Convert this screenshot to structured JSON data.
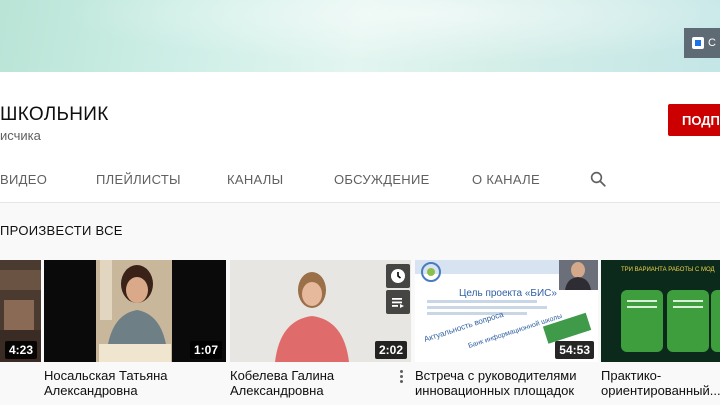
{
  "banner": {
    "link_label": "С"
  },
  "channel": {
    "title": "ШКОЛЬНИК",
    "subscribers": "исчика",
    "subscribe_label": "ПОДПИ"
  },
  "tabs": [
    {
      "label": "ВИДЕО"
    },
    {
      "label": "ПЛЕЙЛИСТЫ"
    },
    {
      "label": "КАНАЛЫ"
    },
    {
      "label": "ОБСУЖДЕНИЕ"
    },
    {
      "label": "О КАНАЛЕ"
    }
  ],
  "section": {
    "play_all": "ПРОИЗВЕСТИ ВСЕ"
  },
  "videos": [
    {
      "duration": "4:23",
      "title_line1": "",
      "title_line2": ""
    },
    {
      "duration": "1:07",
      "title_line1": "Носальская Татьяна",
      "title_line2": "Александровна"
    },
    {
      "duration": "2:02",
      "title_line1": "Кобелева Галина",
      "title_line2": "Александровна"
    },
    {
      "duration": "54:53",
      "title_line1": "Встреча с руководителями",
      "title_line2": "инновационных площадок",
      "slide_title": "Цель проекта «БИС»",
      "slide_text1": "Актуальность вопроса",
      "slide_text2": "Банк информационной школы"
    },
    {
      "duration": "",
      "title_line1": "Практико-",
      "title_line2": "ориентированный...",
      "slide_heading": "ТРИ ВАРИАНТА РАБОТЫ С МОД"
    }
  ],
  "colors": {
    "subscribe": "#cc0000",
    "tab_text": "#606060"
  }
}
